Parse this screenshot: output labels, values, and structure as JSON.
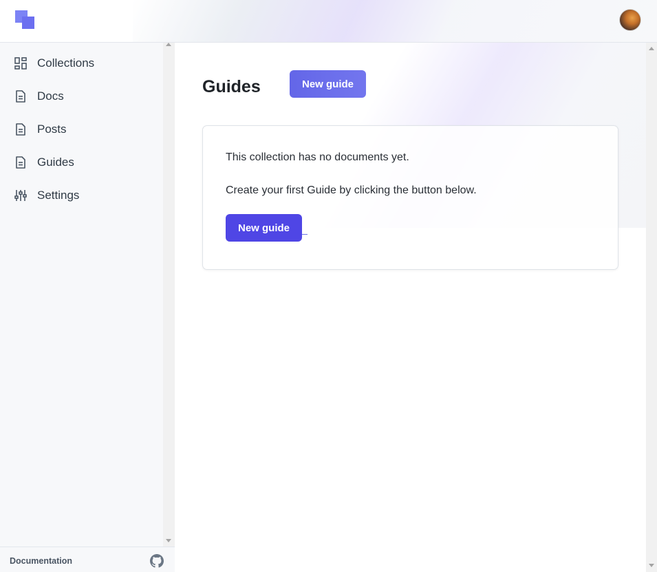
{
  "header": {
    "logo_name": "app-logo",
    "avatar_name": "user-avatar"
  },
  "sidebar": {
    "items": [
      {
        "label": "Collections",
        "icon": "grid-icon"
      },
      {
        "label": "Docs",
        "icon": "document-icon"
      },
      {
        "label": "Posts",
        "icon": "document-icon"
      },
      {
        "label": "Guides",
        "icon": "document-icon"
      },
      {
        "label": "Settings",
        "icon": "sliders-icon"
      }
    ],
    "footer": {
      "documentation_label": "Documentation",
      "github_icon": "github-icon"
    }
  },
  "main": {
    "title": "Guides",
    "new_button_label": "New guide",
    "empty_state": {
      "line1": "This collection has no documents yet.",
      "line2": "Create your first Guide by clicking the button below.",
      "button_label": "New guide"
    }
  },
  "colors": {
    "accent": "#4f46e5",
    "accent_light": "#6366e8",
    "logo": "#7c83f5",
    "sidebar_bg": "#f7f8fa"
  }
}
